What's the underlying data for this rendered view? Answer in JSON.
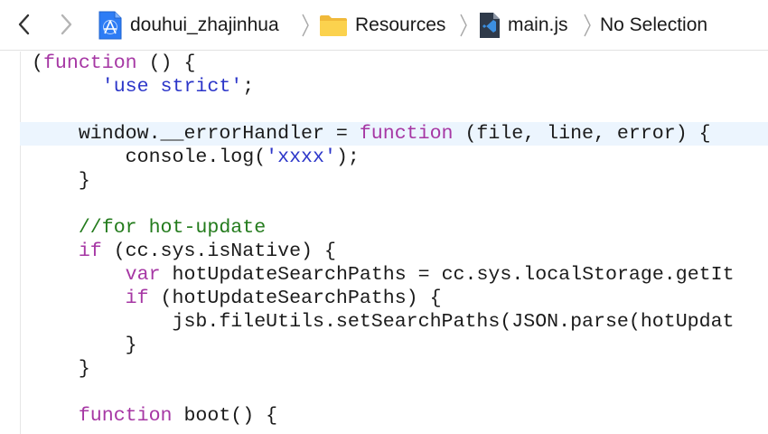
{
  "jumpbar": {
    "project": "douhui_zhajinhua",
    "folder": "Resources",
    "file": "main.js",
    "selection": "No Selection"
  },
  "colors": {
    "keyword": "#a637a4",
    "string": "#2c36c9",
    "comment": "#237b1c",
    "plain": "#1b1b1b",
    "current_line": "#ecf5fe"
  },
  "code": {
    "lines": [
      {
        "current": false,
        "tokens": [
          {
            "t": "plain",
            "v": "("
          },
          {
            "t": "keyword",
            "v": "function"
          },
          {
            "t": "plain",
            "v": " () {"
          }
        ]
      },
      {
        "current": false,
        "tokens": [
          {
            "t": "plain",
            "v": "      "
          },
          {
            "t": "string",
            "v": "'use strict'"
          },
          {
            "t": "plain",
            "v": ";"
          }
        ]
      },
      {
        "current": false,
        "tokens": []
      },
      {
        "current": true,
        "tokens": [
          {
            "t": "plain",
            "v": "    window.__errorHandler = "
          },
          {
            "t": "keyword",
            "v": "function"
          },
          {
            "t": "plain",
            "v": " (file, line, error) {"
          }
        ]
      },
      {
        "current": false,
        "tokens": [
          {
            "t": "plain",
            "v": "        console.log("
          },
          {
            "t": "string",
            "v": "'xxxx'"
          },
          {
            "t": "plain",
            "v": ");"
          }
        ]
      },
      {
        "current": false,
        "tokens": [
          {
            "t": "plain",
            "v": "    }"
          }
        ]
      },
      {
        "current": false,
        "tokens": []
      },
      {
        "current": false,
        "tokens": [
          {
            "t": "plain",
            "v": "    "
          },
          {
            "t": "comment",
            "v": "//for hot-update"
          }
        ]
      },
      {
        "current": false,
        "tokens": [
          {
            "t": "plain",
            "v": "    "
          },
          {
            "t": "keyword",
            "v": "if"
          },
          {
            "t": "plain",
            "v": " (cc.sys.isNative) {"
          }
        ]
      },
      {
        "current": false,
        "tokens": [
          {
            "t": "plain",
            "v": "        "
          },
          {
            "t": "keyword",
            "v": "var"
          },
          {
            "t": "plain",
            "v": " hotUpdateSearchPaths = cc.sys.localStorage.getIt"
          }
        ]
      },
      {
        "current": false,
        "tokens": [
          {
            "t": "plain",
            "v": "        "
          },
          {
            "t": "keyword",
            "v": "if"
          },
          {
            "t": "plain",
            "v": " (hotUpdateSearchPaths) {"
          }
        ]
      },
      {
        "current": false,
        "tokens": [
          {
            "t": "plain",
            "v": "            jsb.fileUtils.setSearchPaths(JSON.parse(hotUpdat"
          }
        ]
      },
      {
        "current": false,
        "tokens": [
          {
            "t": "plain",
            "v": "        }"
          }
        ]
      },
      {
        "current": false,
        "tokens": [
          {
            "t": "plain",
            "v": "    }"
          }
        ]
      },
      {
        "current": false,
        "tokens": []
      },
      {
        "current": false,
        "tokens": [
          {
            "t": "plain",
            "v": "    "
          },
          {
            "t": "keyword",
            "v": "function"
          },
          {
            "t": "plain",
            "v": " boot() {"
          }
        ]
      }
    ]
  }
}
